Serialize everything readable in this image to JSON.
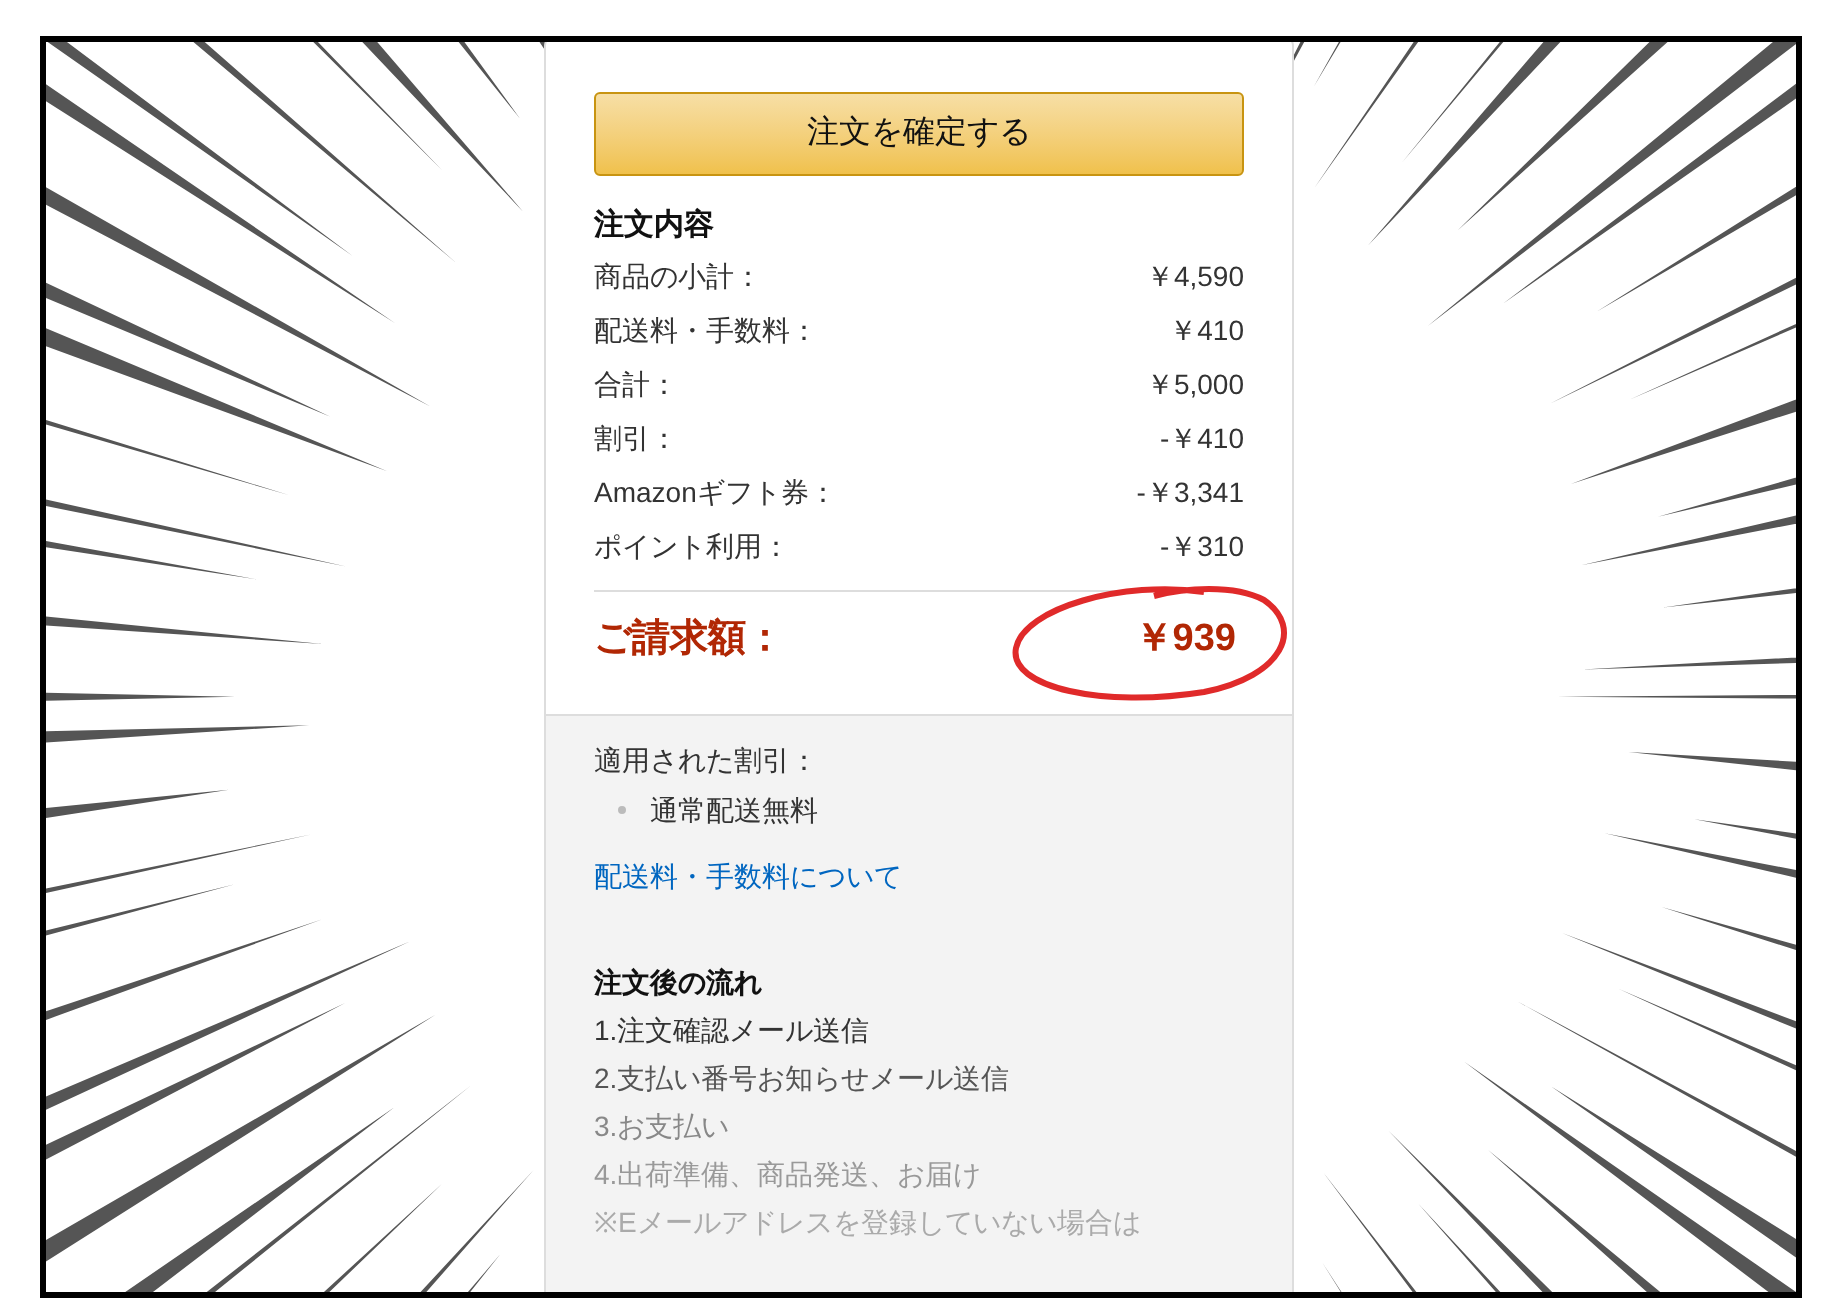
{
  "place_order_button": "注文を確定する",
  "summary": {
    "title": "注文内容",
    "rows": [
      {
        "label": "商品の小計：",
        "value": "￥4,590"
      },
      {
        "label": "配送料・手数料：",
        "value": "￥410"
      },
      {
        "label": "合計：",
        "value": "￥5,000"
      },
      {
        "label": "割引：",
        "value": "-￥410"
      },
      {
        "label": "Amazonギフト券：",
        "value": "-￥3,341"
      },
      {
        "label": "ポイント利用：",
        "value": "-￥310"
      }
    ],
    "total": {
      "label": "ご請求額：",
      "value": "￥939",
      "circled": true
    }
  },
  "discounts": {
    "title": "適用された割引：",
    "items": [
      "通常配送無料"
    ],
    "link": "配送料・手数料について"
  },
  "flow": {
    "title": "注文後の流れ",
    "steps": [
      "1.注文確認メール送信",
      "2.支払い番号お知らせメール送信",
      "3.お支払い",
      "4.出荷準備、商品発送、お届け",
      "※Eメールアドレスを登録していない場合は"
    ]
  }
}
